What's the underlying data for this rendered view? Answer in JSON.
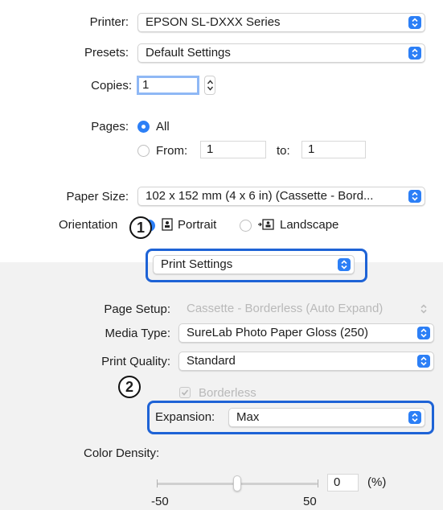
{
  "printer": {
    "label": "Printer:",
    "value": "EPSON SL-DXXX Series"
  },
  "presets": {
    "label": "Presets:",
    "value": "Default Settings"
  },
  "copies": {
    "label": "Copies:",
    "value": "1"
  },
  "pages": {
    "label": "Pages:",
    "all_label": "All",
    "from_label": "From:",
    "from_value": "1",
    "to_label": "to:",
    "to_value": "1",
    "selected": "All"
  },
  "paper_size": {
    "label": "Paper Size:",
    "value": "102 x 152 mm (4 x 6 in) (Cassette - Bord..."
  },
  "orientation": {
    "label": "Orientation",
    "portrait_label": "Portrait",
    "landscape_label": "Landscape",
    "selected": "Portrait"
  },
  "section_popup": {
    "value": "Print Settings"
  },
  "page_setup": {
    "label": "Page Setup:",
    "value": "Cassette - Borderless (Auto Expand)"
  },
  "media_type": {
    "label": "Media Type:",
    "value": "SureLab Photo Paper Gloss (250)"
  },
  "print_quality": {
    "label": "Print Quality:",
    "value": "Standard"
  },
  "borderless": {
    "label": "Borderless",
    "checked": true,
    "disabled": true
  },
  "expansion": {
    "label": "Expansion:",
    "value": "Max"
  },
  "color_density": {
    "label": "Color Density:",
    "value": "0",
    "unit": "(%)",
    "min_label": "-50",
    "max_label": "50",
    "slider_fraction": 0.5
  },
  "callouts": {
    "one": "1",
    "two": "2"
  },
  "colors": {
    "accent": "#2c7ff6",
    "highlight": "#1e63d6",
    "panel": "#f2f2f2"
  }
}
